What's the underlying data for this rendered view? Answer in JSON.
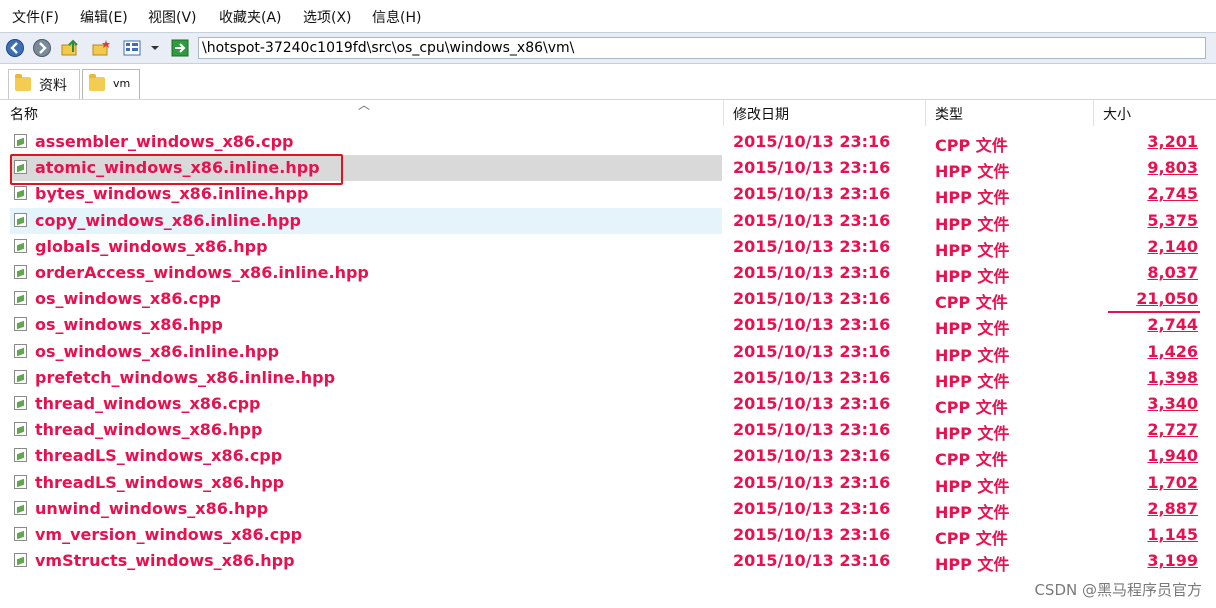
{
  "menu": [
    "文件(F)",
    "编辑(E)",
    "视图(V)",
    "收藏夹(A)",
    "选项(X)",
    "信息(H)"
  ],
  "toolbar": {
    "icons": [
      "back-icon",
      "forward-icon",
      "up-folder-icon",
      "new-folder-icon",
      "view-mode-icon",
      "dropdown-icon",
      "go-icon"
    ],
    "address": "\\hotspot-37240c1019fd\\src\\os_cpu\\windows_x86\\vm\\"
  },
  "tabs": [
    {
      "label": "资料"
    },
    {
      "label": "vm"
    }
  ],
  "columns": {
    "name": "名称",
    "date": "修改日期",
    "type": "类型",
    "size": "大小"
  },
  "files": [
    {
      "name": "assembler_windows_x86.cpp",
      "date": "2015/10/13 23:16",
      "type": "CPP 文件",
      "size": "3,201"
    },
    {
      "name": "atomic_windows_x86.inline.hpp",
      "date": "2015/10/13 23:16",
      "type": "HPP 文件",
      "size": "9,803"
    },
    {
      "name": "bytes_windows_x86.inline.hpp",
      "date": "2015/10/13 23:16",
      "type": "HPP 文件",
      "size": "2,745"
    },
    {
      "name": "copy_windows_x86.inline.hpp",
      "date": "2015/10/13 23:16",
      "type": "HPP 文件",
      "size": "5,375"
    },
    {
      "name": "globals_windows_x86.hpp",
      "date": "2015/10/13 23:16",
      "type": "HPP 文件",
      "size": "2,140"
    },
    {
      "name": "orderAccess_windows_x86.inline.hpp",
      "date": "2015/10/13 23:16",
      "type": "HPP 文件",
      "size": "8,037"
    },
    {
      "name": "os_windows_x86.cpp",
      "date": "2015/10/13 23:16",
      "type": "CPP 文件",
      "size": "21,050"
    },
    {
      "name": "os_windows_x86.hpp",
      "date": "2015/10/13 23:16",
      "type": "HPP 文件",
      "size": "2,744"
    },
    {
      "name": "os_windows_x86.inline.hpp",
      "date": "2015/10/13 23:16",
      "type": "HPP 文件",
      "size": "1,426"
    },
    {
      "name": "prefetch_windows_x86.inline.hpp",
      "date": "2015/10/13 23:16",
      "type": "HPP 文件",
      "size": "1,398"
    },
    {
      "name": "thread_windows_x86.cpp",
      "date": "2015/10/13 23:16",
      "type": "CPP 文件",
      "size": "3,340"
    },
    {
      "name": "thread_windows_x86.hpp",
      "date": "2015/10/13 23:16",
      "type": "HPP 文件",
      "size": "2,727"
    },
    {
      "name": "threadLS_windows_x86.cpp",
      "date": "2015/10/13 23:16",
      "type": "CPP 文件",
      "size": "1,940"
    },
    {
      "name": "threadLS_windows_x86.hpp",
      "date": "2015/10/13 23:16",
      "type": "HPP 文件",
      "size": "1,702"
    },
    {
      "name": "unwind_windows_x86.hpp",
      "date": "2015/10/13 23:16",
      "type": "HPP 文件",
      "size": "2,887"
    },
    {
      "name": "vm_version_windows_x86.cpp",
      "date": "2015/10/13 23:16",
      "type": "CPP 文件",
      "size": "1,145"
    },
    {
      "name": "vmStructs_windows_x86.hpp",
      "date": "2015/10/13 23:16",
      "type": "HPP 文件",
      "size": "3,199"
    }
  ],
  "selected_index": 1,
  "hover_index": 3,
  "colors": {
    "file_text": "#e8114f",
    "annotation_box": "#e0141e",
    "selected_row": "#d9d9d9",
    "hover_row": "#e5f3fb"
  },
  "watermark": "CSDN @黑马程序员官方"
}
